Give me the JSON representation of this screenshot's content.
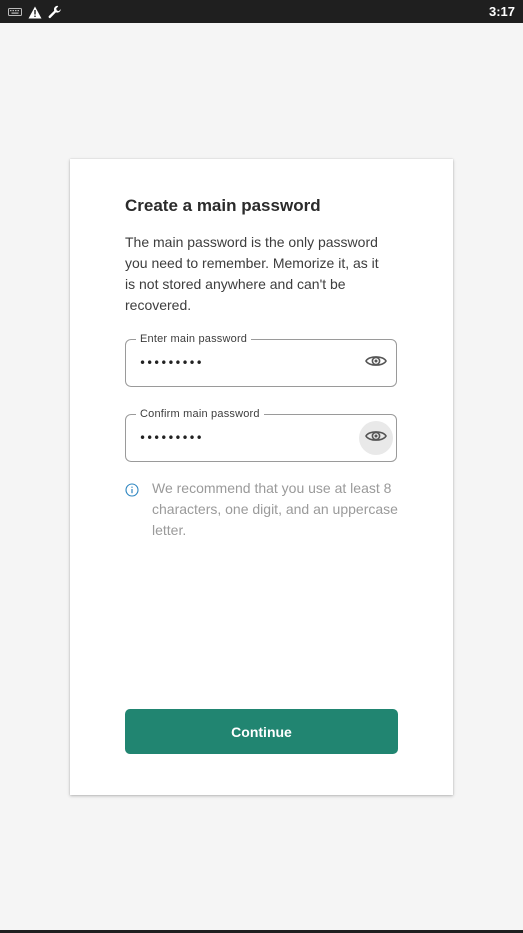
{
  "status_bar": {
    "time": "3:17",
    "icons": [
      "keyboard-icon",
      "warning-icon",
      "wrench-icon"
    ]
  },
  "card": {
    "title": "Create a main password",
    "description": "The main password is the only password you need to remember. Memorize it, as it is not stored anywhere and can't be recovered.",
    "fields": [
      {
        "label": "Enter main password",
        "value": "•••••••••",
        "toggle_icon": "eye-icon"
      },
      {
        "label": "Confirm main password",
        "value": "•••••••••",
        "toggle_icon": "eye-icon"
      }
    ],
    "hint": {
      "icon": "info-icon",
      "text": "We recommend that you use at least 8 characters, one digit, and an uppercase letter."
    },
    "continue_label": "Continue"
  },
  "colors": {
    "accent": "#218571",
    "status_bar": "#1f1f1f",
    "background": "#f5f5f5",
    "hint_text": "#9a9a9a"
  }
}
